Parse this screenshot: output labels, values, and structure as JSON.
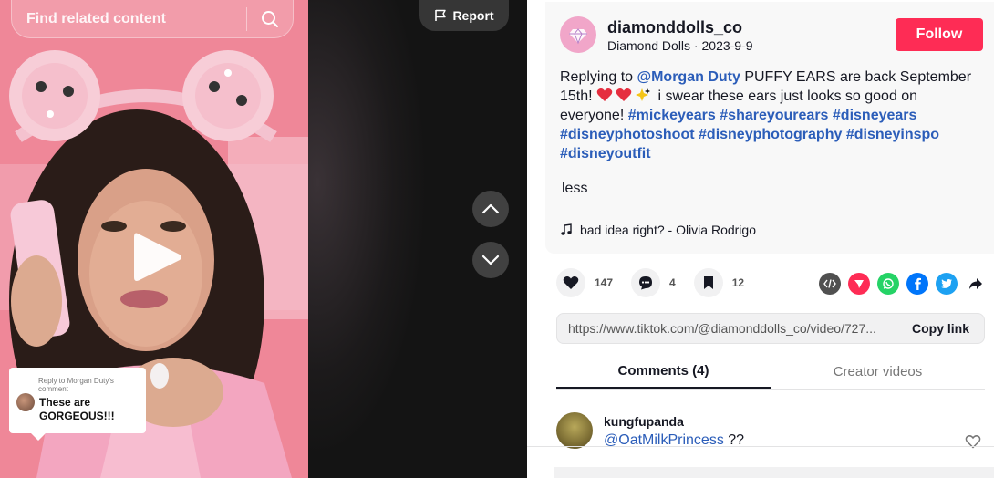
{
  "video": {
    "search_placeholder": "Find related content",
    "report_label": "Report",
    "reply_card": {
      "meta": "Reply to Morgan Duty's comment",
      "text": "These are GORGEOUS!!!"
    }
  },
  "author": {
    "username": "diamonddolls_co",
    "display_name": "Diamond Dolls",
    "separator": " · ",
    "date": "2023-9-9",
    "follow_label": "Follow"
  },
  "caption": {
    "reply_prefix": "Replying to ",
    "mention": "@Morgan Duty",
    "text": " PUFFY EARS are back September 15th! ",
    "text2": " i swear these ears just looks so good on everyone! ",
    "hashtags": [
      "#mickeyears",
      "#shareyourears",
      "#disneyears",
      "#disneyphotoshoot",
      "#disneyphotography",
      "#disneyinspo",
      "#disneyoutfit"
    ],
    "less_label": "less",
    "music": "bad idea right? - Olivia Rodrigo"
  },
  "stats": {
    "likes": "147",
    "comments": "4",
    "saves": "12"
  },
  "share_icons": [
    "embed-icon",
    "send-icon",
    "whatsapp-icon",
    "facebook-icon",
    "twitter-icon",
    "share-arrow-icon"
  ],
  "colors": {
    "accent": "#fe2c55",
    "link": "#2b5db9",
    "whatsapp": "#25d366",
    "facebook": "#0075fa",
    "twitter": "#1da1f2",
    "send": "#fe2c55",
    "embed": "#505050"
  },
  "link": {
    "url": "https://www.tiktok.com/@diamonddolls_co/video/727...",
    "copy_label": "Copy link"
  },
  "tabs": [
    {
      "label": "Comments (4)"
    },
    {
      "label": "Creator videos"
    }
  ],
  "comments": [
    {
      "user": "kungfupanda",
      "mention": "@OatMilkPrincess",
      "text": " ??"
    }
  ]
}
